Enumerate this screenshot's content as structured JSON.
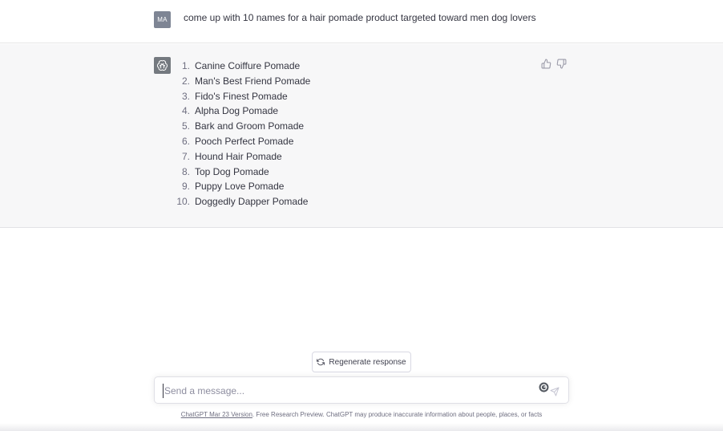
{
  "user_message": {
    "avatar_initials": "MA",
    "text": "come up with 10 names for a hair pomade product targeted toward men dog lovers"
  },
  "assistant_message": {
    "avatar_icon": "openai-logo-icon",
    "items": [
      {
        "num": "1.",
        "text": "Canine Coiffure Pomade"
      },
      {
        "num": "2.",
        "text": "Man's Best Friend Pomade"
      },
      {
        "num": "3.",
        "text": "Fido's Finest Pomade"
      },
      {
        "num": "4.",
        "text": "Alpha Dog Pomade"
      },
      {
        "num": "5.",
        "text": "Bark and Groom Pomade"
      },
      {
        "num": "6.",
        "text": "Pooch Perfect Pomade"
      },
      {
        "num": "7.",
        "text": "Hound Hair Pomade"
      },
      {
        "num": "8.",
        "text": "Top Dog Pomade"
      },
      {
        "num": "9.",
        "text": "Puppy Love Pomade"
      },
      {
        "num": "10.",
        "text": "Doggedly Dapper Pomade"
      }
    ],
    "feedback": {
      "thumbs_up_icon": "thumbs-up-icon",
      "thumbs_down_icon": "thumbs-down-icon"
    }
  },
  "regenerate": {
    "label": "Regenerate response",
    "icon": "refresh-icon"
  },
  "composer": {
    "placeholder": "Send a message...",
    "value": "",
    "send_icon": "send-icon",
    "extension_icon": "grammar-extension-icon"
  },
  "footer": {
    "link_text": "ChatGPT Mar 23 Version",
    "text": ". Free Research Preview. ChatGPT may produce inaccurate information about people, places, or facts"
  },
  "colors": {
    "assistant_bg": "#f7f7f8",
    "user_avatar_bg": "#7e8594",
    "assistant_avatar_bg": "#74797f",
    "text": "#343541"
  }
}
